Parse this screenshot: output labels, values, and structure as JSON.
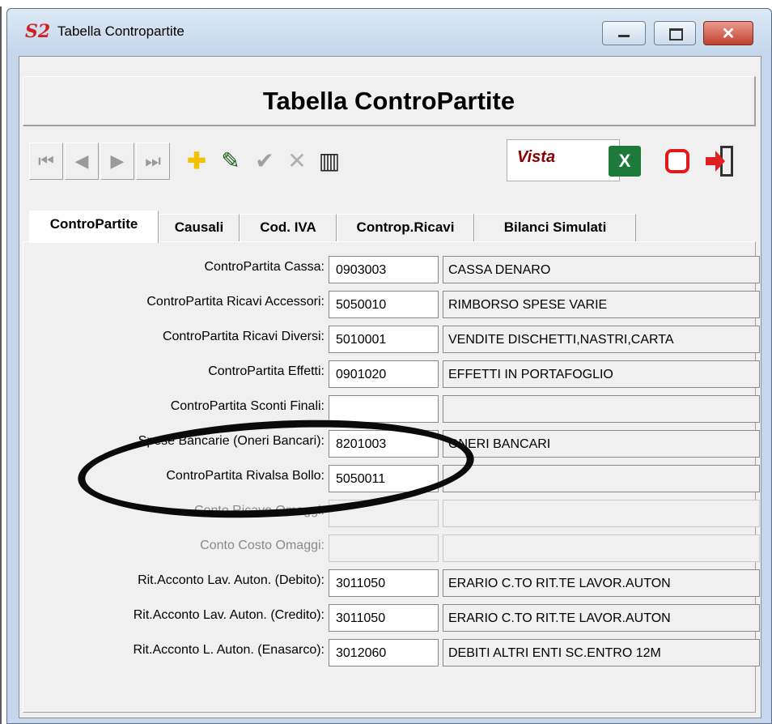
{
  "window": {
    "app_icon": "S2 app-logo-icon",
    "title": "Tabella Contropartite",
    "controls": [
      "minimize-icon",
      "maximize-icon",
      "close-icon"
    ]
  },
  "header": {
    "title": "Tabella ControPartite"
  },
  "toolbar": {
    "nav_buttons": [
      {
        "name": "first-record-button",
        "glyph": "⏮"
      },
      {
        "name": "previous-record-button",
        "glyph": "◀"
      },
      {
        "name": "next-record-button",
        "glyph": "▶"
      },
      {
        "name": "last-record-button",
        "glyph": "⏭"
      }
    ],
    "action_icons": [
      {
        "name": "add-icon",
        "glyph": "✚",
        "color": "#f2c200"
      },
      {
        "name": "edit-icon",
        "glyph": "✎",
        "color": "#1a5a1a"
      },
      {
        "name": "confirm-icon",
        "glyph": "✔",
        "color": "#a0a0a0"
      },
      {
        "name": "cancel-icon",
        "glyph": "✕",
        "color": "#b0b0b0"
      },
      {
        "name": "delete-trash-icon",
        "glyph": "🗑",
        "color": "#222222"
      }
    ],
    "view_label": "Vista",
    "excel_icon": "X",
    "print_icon": "printer-icon",
    "exit_icon": "exit-door-icon"
  },
  "tabs": [
    "ControPartite",
    "Causali",
    "Cod. IVA",
    "Controp.Ricavi",
    "Bilanci Simulati"
  ],
  "rows": [
    {
      "label": "ControPartita Cassa:",
      "code": "0903003",
      "desc": "CASSA DENARO",
      "enabled": true
    },
    {
      "label": "ControPartita Ricavi Accessori:",
      "code": "5050010",
      "desc": "RIMBORSO SPESE VARIE",
      "enabled": true
    },
    {
      "label": "ControPartita Ricavi Diversi:",
      "code": "5010001",
      "desc": "VENDITE DISCHETTI,NASTRI,CARTA",
      "enabled": true
    },
    {
      "label": "ControPartita Effetti:",
      "code": "0901020",
      "desc": "EFFETTI IN PORTAFOGLIO",
      "enabled": true
    },
    {
      "label": "ControPartita Sconti Finali:",
      "code": "",
      "desc": "",
      "enabled": true
    },
    {
      "label": "Spese Bancarie (Oneri Bancari):",
      "code": "8201003",
      "desc": "ONERI BANCARI",
      "enabled": true
    },
    {
      "label": "ControPartita Rivalsa Bollo:",
      "code": "5050011",
      "desc": "",
      "enabled": true
    },
    {
      "label": "Conto Ricavo Omaggi:",
      "code": "",
      "desc": "",
      "enabled": false
    },
    {
      "label": "Conto Costo Omaggi:",
      "code": "",
      "desc": "",
      "enabled": false
    },
    {
      "label": "Rit.Acconto Lav. Auton. (Debito):",
      "code": "3011050",
      "desc": "ERARIO C.TO RIT.TE LAVOR.AUTON",
      "enabled": true
    },
    {
      "label": "Rit.Acconto Lav. Auton. (Credito):",
      "code": "3011050",
      "desc": "ERARIO C.TO RIT.TE LAVOR.AUTON",
      "enabled": true
    },
    {
      "label": "Rit.Acconto L. Auton. (Enasarco):",
      "code": "3012060",
      "desc": "DEBITI ALTRI ENTI SC.ENTRO 12M",
      "enabled": true
    }
  ],
  "annotation": "hand-drawn-ellipse-highlight"
}
